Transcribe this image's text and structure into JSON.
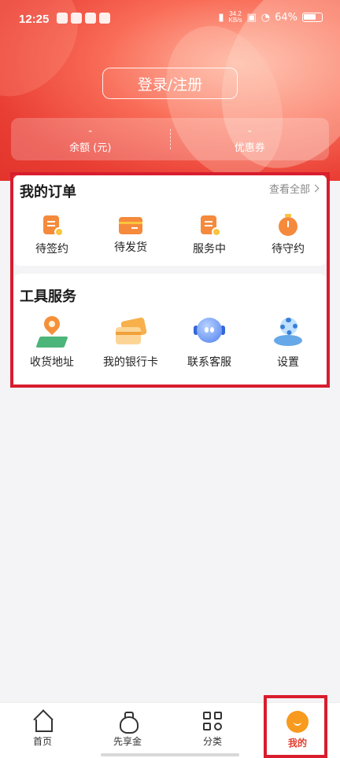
{
  "status_bar": {
    "time": "12:25",
    "net_speed_value": "34.2",
    "net_speed_unit": "KB/s",
    "battery": "64%"
  },
  "header": {
    "login_label": "登录/注册",
    "balance_value": "-",
    "balance_label": "余额 (元)",
    "coupon_value": "-",
    "coupon_label": "优惠券"
  },
  "orders": {
    "title": "我的订单",
    "view_all": "查看全部",
    "items": [
      {
        "label": "待签约",
        "icon": "pending-sign-icon"
      },
      {
        "label": "待发货",
        "icon": "pending-ship-icon"
      },
      {
        "label": "服务中",
        "icon": "in-service-icon"
      },
      {
        "label": "待守约",
        "icon": "pending-commit-icon"
      }
    ]
  },
  "tools": {
    "title": "工具服务",
    "items": [
      {
        "label": "收货地址",
        "icon": "location-pin-icon"
      },
      {
        "label": "我的银行卡",
        "icon": "bank-card-icon"
      },
      {
        "label": "联系客服",
        "icon": "customer-service-icon"
      },
      {
        "label": "设置",
        "icon": "settings-gear-icon"
      }
    ]
  },
  "bottom_nav": {
    "items": [
      {
        "label": "首页",
        "icon": "home-icon"
      },
      {
        "label": "先享金",
        "icon": "money-bag-icon"
      },
      {
        "label": "分类",
        "icon": "category-grid-icon"
      },
      {
        "label": "我的",
        "icon": "profile-icon",
        "active": true
      }
    ]
  },
  "colors": {
    "brand_red": "#e23e2e",
    "accent_orange": "#f58a3c",
    "highlight_outline": "#d81d2e"
  }
}
